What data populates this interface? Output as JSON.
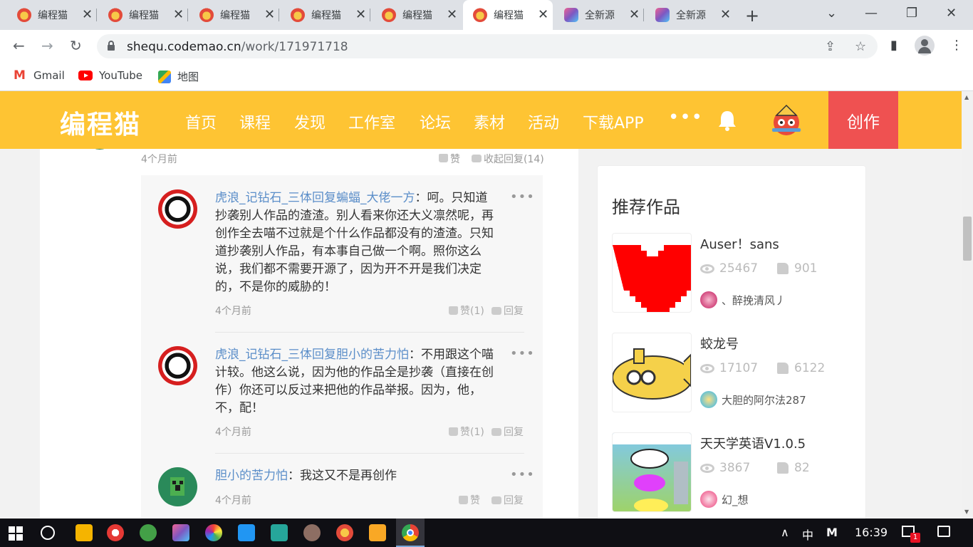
{
  "browser": {
    "tabs": [
      {
        "title": "编程猫",
        "icon": "codemao-icon"
      },
      {
        "title": "编程猫",
        "icon": "codemao-icon"
      },
      {
        "title": "编程猫",
        "icon": "codemao-icon"
      },
      {
        "title": "编程猫",
        "icon": "codemao-icon"
      },
      {
        "title": "编程猫",
        "icon": "codemao-icon"
      },
      {
        "title": "编程猫",
        "icon": "codemao-icon"
      },
      {
        "title": "全新源",
        "icon": "build-icon"
      },
      {
        "title": "全新源",
        "icon": "build-icon"
      }
    ],
    "new_tab": "+",
    "close_glyph": "✕",
    "url_host": "shequ.codemao.cn",
    "url_path": "/work/171971718",
    "bookmarks": [
      "Gmail",
      "YouTube",
      "地图"
    ]
  },
  "site": {
    "logo": "编程猫",
    "nav": [
      "首页",
      "课程",
      "发现",
      "工作室",
      "论坛",
      "素材",
      "活动",
      "下载APP"
    ],
    "more": "•••",
    "create": "创作",
    "brand_color": "#fec433",
    "create_color": "#ef5151"
  },
  "comment": {
    "time": "4个月前",
    "like": "赞",
    "collapse": "收起回复(14)"
  },
  "replies": [
    {
      "user": "虎浪_记钻石_三体",
      "reply_word": "回复",
      "target": "蝙蝠_大佬一方",
      "text": "：呵。只知道抄袭别人作品的渣渣。别人看来你还大义凛然呢，再创作全去喵不过就是个什么作品都没有的渣渣。只知道抄袭别人作品，有本事自己做一个啊。照你这么说，我们都不需要开源了，因为开不开是我们决定的，不是你的威胁的！",
      "time": "4个月前",
      "like": "赞(1)",
      "reply": "回复"
    },
    {
      "user": "虎浪_记钻石_三体",
      "reply_word": "回复",
      "target": "胆小的苦力怕",
      "text": "：不用跟这个喵计较。他这么说，因为他的作品全是抄袭（直接在创作）你还可以反过来把他的作品举报。因为，他，不，配！",
      "time": "4个月前",
      "like": "赞(1)",
      "reply": "回复"
    },
    {
      "user": "胆小的苦力怕",
      "reply_word": "",
      "target": "",
      "text": "：我这又不是再创作",
      "time": "4个月前",
      "like": "赞",
      "reply": "回复"
    }
  ],
  "dots": "•••",
  "sidebar": {
    "title": "推荐作品",
    "works": [
      {
        "title": "Auser！sans",
        "views": "25467",
        "likes": "901",
        "author": "、醉挽清风丿"
      },
      {
        "title": "蛟龙号",
        "views": "17107",
        "likes": "6122",
        "author": "大胆的阿尔法287"
      },
      {
        "title": "天天学英语V1.0.5",
        "views": "3867",
        "likes": "82",
        "author": "幻_想"
      }
    ]
  },
  "taskbar": {
    "ime": "中",
    "ime_mode": "M",
    "clock": "16:39",
    "notification_count": "1",
    "tray_caret": "∧"
  }
}
